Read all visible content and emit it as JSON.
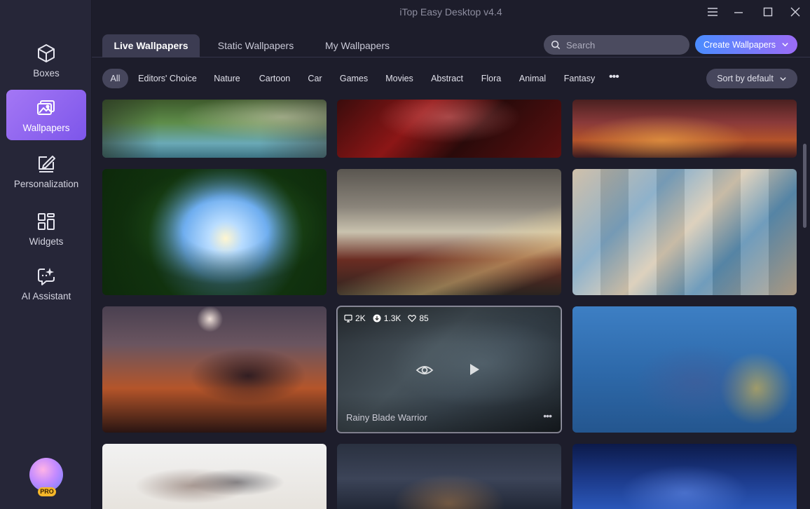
{
  "app": {
    "title": "iTop Easy Desktop v4.4"
  },
  "sidebar": {
    "items": [
      {
        "label": "Boxes",
        "icon": "cube-icon",
        "active": false
      },
      {
        "label": "Wallpapers",
        "icon": "image-icon",
        "active": true
      },
      {
        "label": "Personalization",
        "icon": "pen-frame-icon",
        "active": false
      },
      {
        "label": "Widgets",
        "icon": "widgets-icon",
        "active": false
      },
      {
        "label": "AI Assistant",
        "icon": "ai-chat-icon",
        "active": false
      }
    ],
    "pro_badge": "PRO"
  },
  "tabs": [
    {
      "label": "Live Wallpapers",
      "active": true
    },
    {
      "label": "Static Wallpapers",
      "active": false
    },
    {
      "label": "My Wallpapers",
      "active": false
    }
  ],
  "search": {
    "placeholder": "Search",
    "value": ""
  },
  "create_button": {
    "label": "Create Wallpapers"
  },
  "filters": {
    "categories": [
      "All",
      "Editors' Choice",
      "Nature",
      "Cartoon",
      "Car",
      "Games",
      "Movies",
      "Abstract",
      "Flora",
      "Animal",
      "Fantasy"
    ],
    "active": "All",
    "more": "•••"
  },
  "sort": {
    "label": "Sort by default"
  },
  "hover_card": {
    "title": "Rainy Blade Warrior",
    "stats": {
      "views": "2K",
      "downloads": "1.3K",
      "likes": "85"
    },
    "more": "•••"
  },
  "colors": {
    "accent_purple": "#8f63f0",
    "accent_blue": "#4a8cff",
    "background": "#1d1d2b",
    "sidebar": "#262638",
    "pro": "#f5b72a"
  }
}
